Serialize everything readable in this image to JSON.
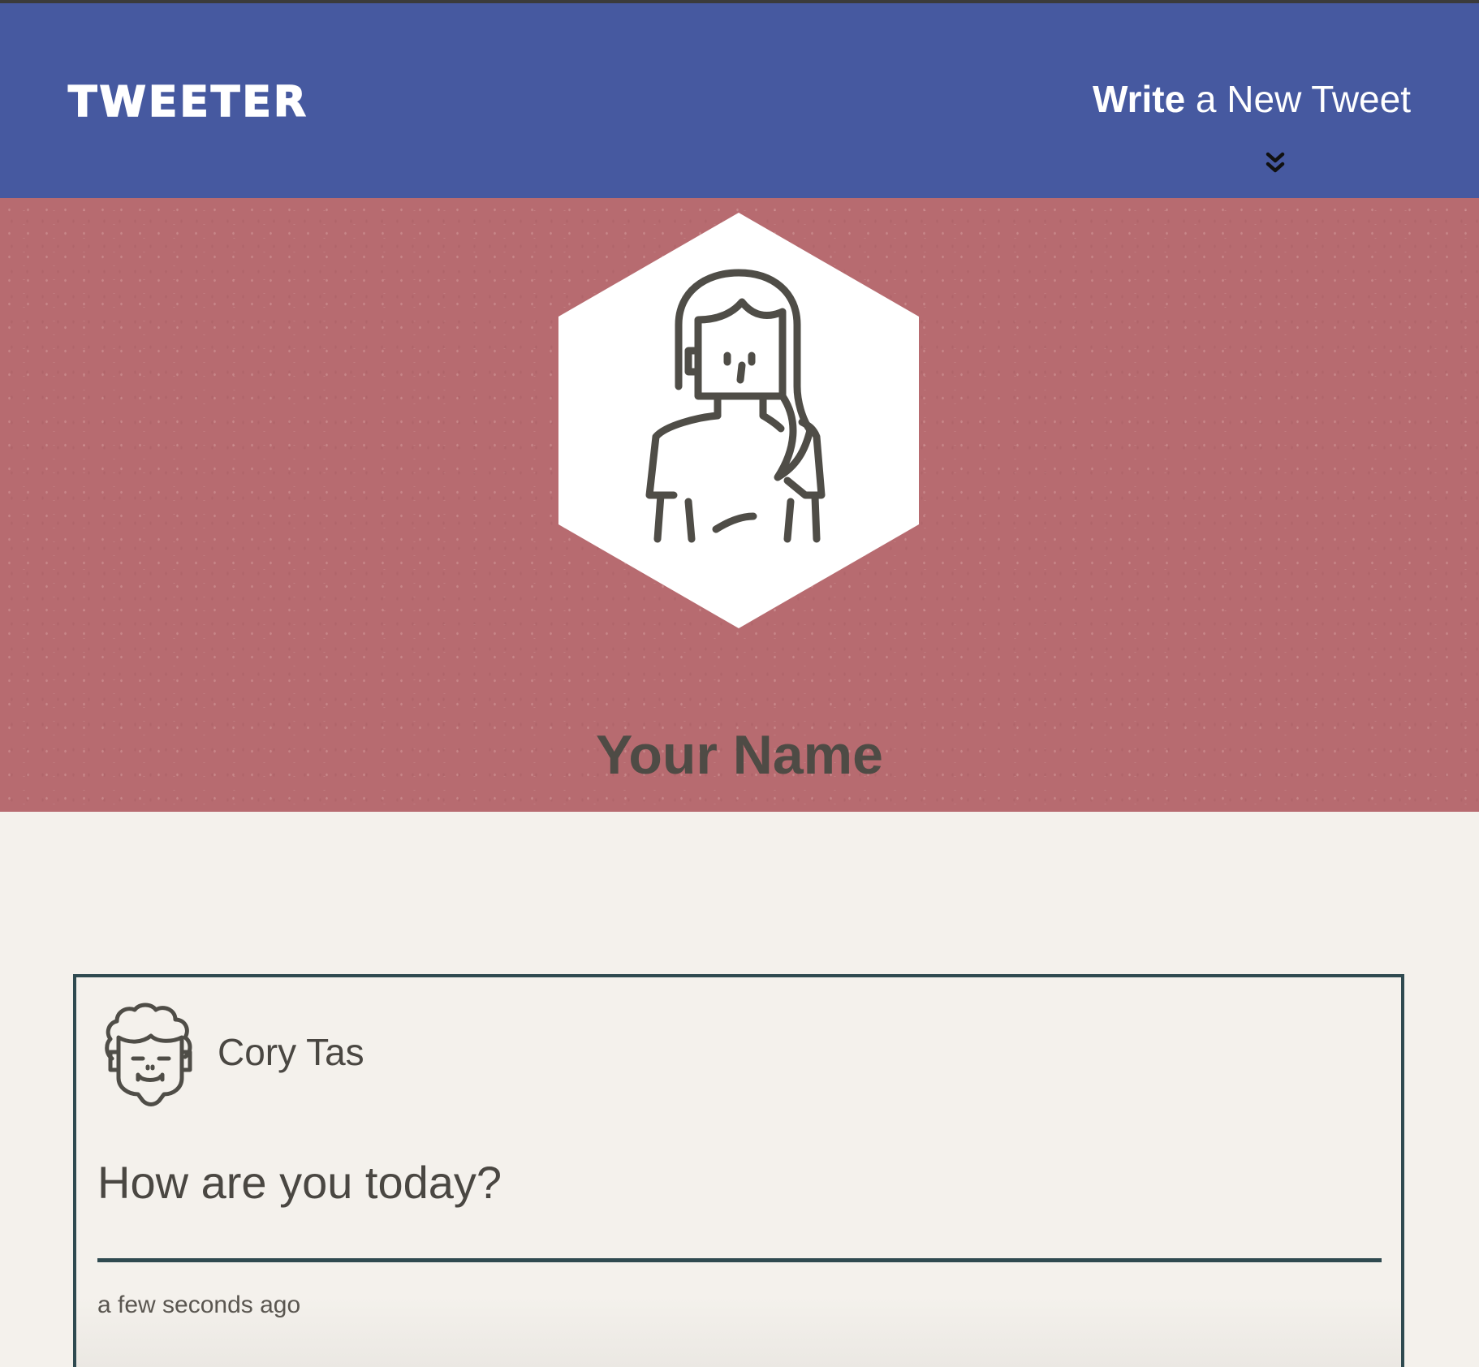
{
  "nav": {
    "brand": "TWEETER",
    "compose_strong": "Write",
    "compose_rest": " a New Tweet",
    "chevron_icon": "double-chevron-down-icon"
  },
  "profile": {
    "name": "Your Name",
    "avatar_icon": "woman-avatar-icon",
    "background_color": "#b76b70"
  },
  "tweet": {
    "author": "Cory Tas",
    "avatar_icon": "curly-hair-man-avatar-icon",
    "content": "How are you today?",
    "timestamp": "a few seconds ago"
  },
  "colors": {
    "nav": "#4659a0",
    "page": "#f4f1ec",
    "text": "#4e4b45",
    "border": "#2f4a50"
  }
}
